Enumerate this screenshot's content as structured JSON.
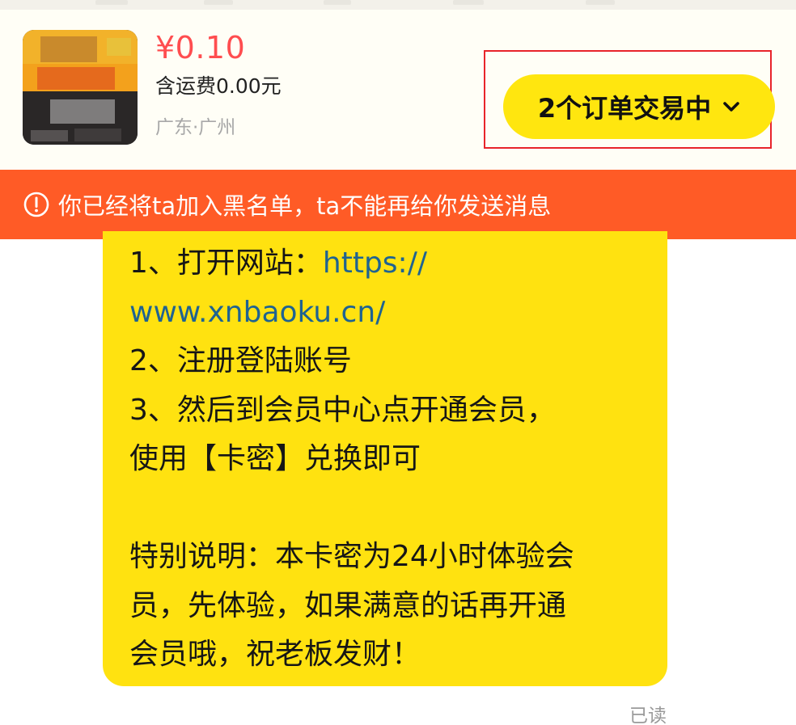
{
  "product": {
    "price": "¥0.10",
    "shipping": "含运费0.00元",
    "location": "广东·广州"
  },
  "order_button": {
    "label": "2个订单交易中",
    "icon": "chevron-down-icon"
  },
  "banner": {
    "icon": "warning-circle-icon",
    "text": "你已经将ta加入黑名单，ta不能再给你发送消息"
  },
  "message": {
    "step1_prefix": "1、打开网站：",
    "step1_link_a": "https://",
    "step1_link_b": "www.xnbaoku.cn/",
    "step2": "2、注册登陆账号",
    "step3_a": "3、然后到会员中心点开通会员，",
    "step3_b": "使用【卡密】兑换即可",
    "note_a": "特别说明：本卡密为24小时体验会",
    "note_b": "员，先体验，如果满意的话再开通",
    "note_c": "会员哦，祝老板发财！"
  },
  "read_status": "已读",
  "colors": {
    "price_red": "#ff4d4f",
    "accent_yellow": "#ffe60f",
    "banner_orange": "#ff5b26",
    "highlight_red": "#e8242b",
    "link_blue": "#1f6391"
  }
}
